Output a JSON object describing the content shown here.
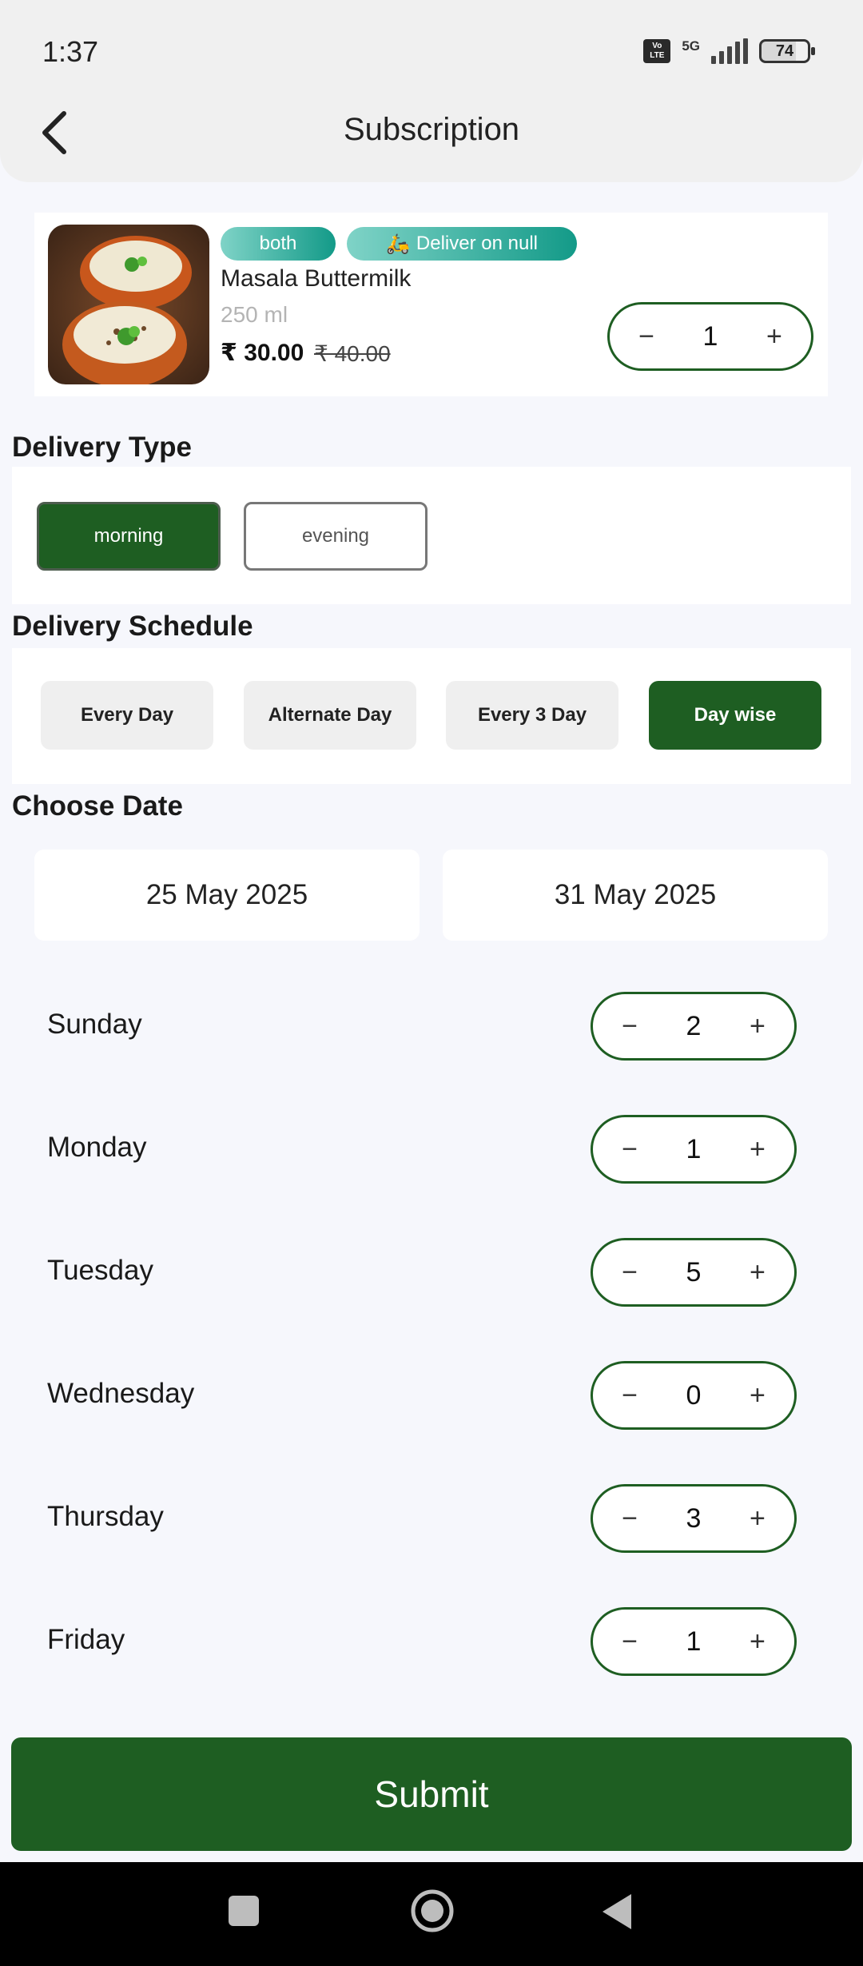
{
  "status_bar": {
    "time": "1:37",
    "volte_label_top": "Vo",
    "volte_label_bottom": "LTE",
    "network": "5G",
    "battery": "74"
  },
  "app_bar": {
    "title": "Subscription",
    "back_icon": "chevron-left-icon"
  },
  "product": {
    "tag_type": "both",
    "tag_delivery": "Deliver on null",
    "tag_delivery_icon": "🛵",
    "name": "Masala Buttermilk",
    "size": "250 ml",
    "price": "₹ 30.00",
    "old_price": "₹ 40.00",
    "quantity": "1"
  },
  "delivery_type": {
    "title": "Delivery Type",
    "options": [
      "morning",
      "evening"
    ],
    "selected": "morning"
  },
  "delivery_schedule": {
    "title": "Delivery Schedule",
    "options": [
      "Every Day",
      "Alternate Day",
      "Every 3 Day",
      "Day wise"
    ],
    "selected": "Day wise"
  },
  "choose_date": {
    "title": "Choose Date",
    "start": "25 May 2025",
    "end": "31 May 2025"
  },
  "days": [
    {
      "label": "Sunday",
      "qty": "2"
    },
    {
      "label": "Monday",
      "qty": "1"
    },
    {
      "label": "Tuesday",
      "qty": "5"
    },
    {
      "label": "Wednesday",
      "qty": "0"
    },
    {
      "label": "Thursday",
      "qty": "3"
    },
    {
      "label": "Friday",
      "qty": "1"
    }
  ],
  "stepper_symbols": {
    "minus": "−",
    "plus": "+"
  },
  "submit_label": "Submit",
  "colors": {
    "primary_green": "#1e5e22",
    "tag_gradient_start": "#7fd3c7",
    "tag_gradient_end": "#139a88",
    "background": "#f6f7fc"
  }
}
